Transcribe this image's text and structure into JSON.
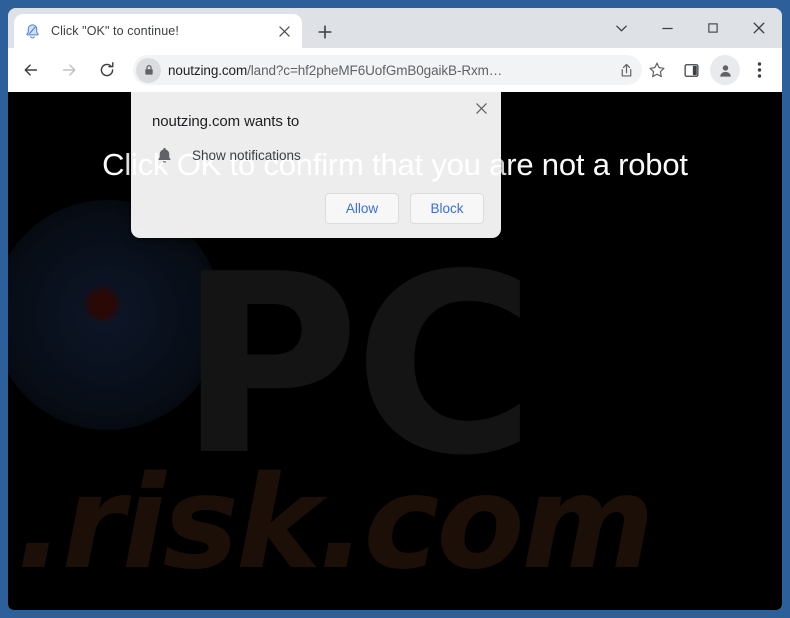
{
  "window": {
    "controls": [
      {
        "name": "tab-search",
        "glyph": "chevron-down"
      },
      {
        "name": "minimize",
        "glyph": "minimize"
      },
      {
        "name": "maximize",
        "glyph": "maximize"
      },
      {
        "name": "close",
        "glyph": "close"
      }
    ]
  },
  "tabs": {
    "active": {
      "title": "Click \"OK\" to continue!",
      "favicon": "bell-icon",
      "close_label": "×"
    },
    "new_tab_label": "+"
  },
  "toolbar": {
    "back_label": "←",
    "forward_label": "→",
    "reload_label": "↻",
    "lock_icon": "lock-icon",
    "url_host": "noutzing.com",
    "url_path": "/land?c=hf2pheMF6UofGmB0gaikB-Rxm…",
    "share_icon": "share-icon",
    "bookmark_icon": "star-icon",
    "side_panel_icon": "side-panel-icon",
    "profile_icon": "profile-avatar-icon",
    "menu_icon": "three-dot-menu-icon"
  },
  "page": {
    "heading": "Click OK to confirm that you are not a robot",
    "background_color": "#000000",
    "watermark_primary": "PC",
    "watermark_secondary": ".risk.com"
  },
  "permission_dialog": {
    "title": "noutzing.com wants to",
    "option_icon": "bell-icon",
    "option_label": "Show notifications",
    "allow_label": "Allow",
    "block_label": "Block",
    "close_label": "✕",
    "accent_color": "#3b6fd4"
  }
}
